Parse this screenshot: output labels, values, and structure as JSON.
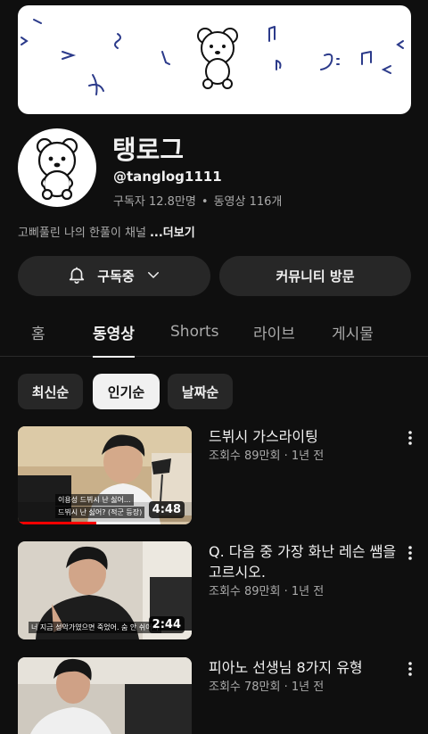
{
  "channel": {
    "name": "탱로그",
    "handle": "@tanglog1111",
    "subscribers": "구독자 12.8만명",
    "videos_count": "동영상 116개",
    "separator": "•",
    "description": "고삐풀린 나의 한풀이 채널",
    "more_label": "...더보기"
  },
  "actions": {
    "subscribed_label": "구독중",
    "community_label": "커뮤니티 방문"
  },
  "tabs": [
    {
      "label": "홈",
      "active": false
    },
    {
      "label": "동영상",
      "active": true
    },
    {
      "label": "Shorts",
      "active": false
    },
    {
      "label": "라이브",
      "active": false
    },
    {
      "label": "게시물",
      "active": false
    }
  ],
  "filters": [
    {
      "label": "최신순",
      "active": false
    },
    {
      "label": "인기순",
      "active": true
    },
    {
      "label": "날짜순",
      "active": false
    }
  ],
  "videos": [
    {
      "title": "드뷔시 가스라이팅",
      "meta": "조회수 89만회 · 1년 전",
      "duration": "4:48",
      "captions": [
        "이용성   드뷔시 난 싫어...",
        "드뷔시 난 싫어? (적군 등장)"
      ],
      "progress": 0.45
    },
    {
      "title": "Q. 다음 중 가장 화난 레슨 쌤을 고르시오.",
      "meta": "조회수 89만회 · 1년 전",
      "duration": "2:44",
      "captions": [
        "너 지금 성악가였으면 죽었어. 숨 안 쉬어서"
      ]
    },
    {
      "title": "피아노 선생님 8가지 유형",
      "meta": "조회수 78만회 · 1년 전"
    }
  ],
  "colors": {
    "background": "#0f0f0f",
    "surface": "#272727",
    "text": "#f1f1f1",
    "secondary_text": "#aaaaaa",
    "accent": "#ff0000"
  },
  "icons": {
    "bell": "bell-icon",
    "chevron": "chevron-down-icon",
    "more": "more-vert-icon"
  }
}
